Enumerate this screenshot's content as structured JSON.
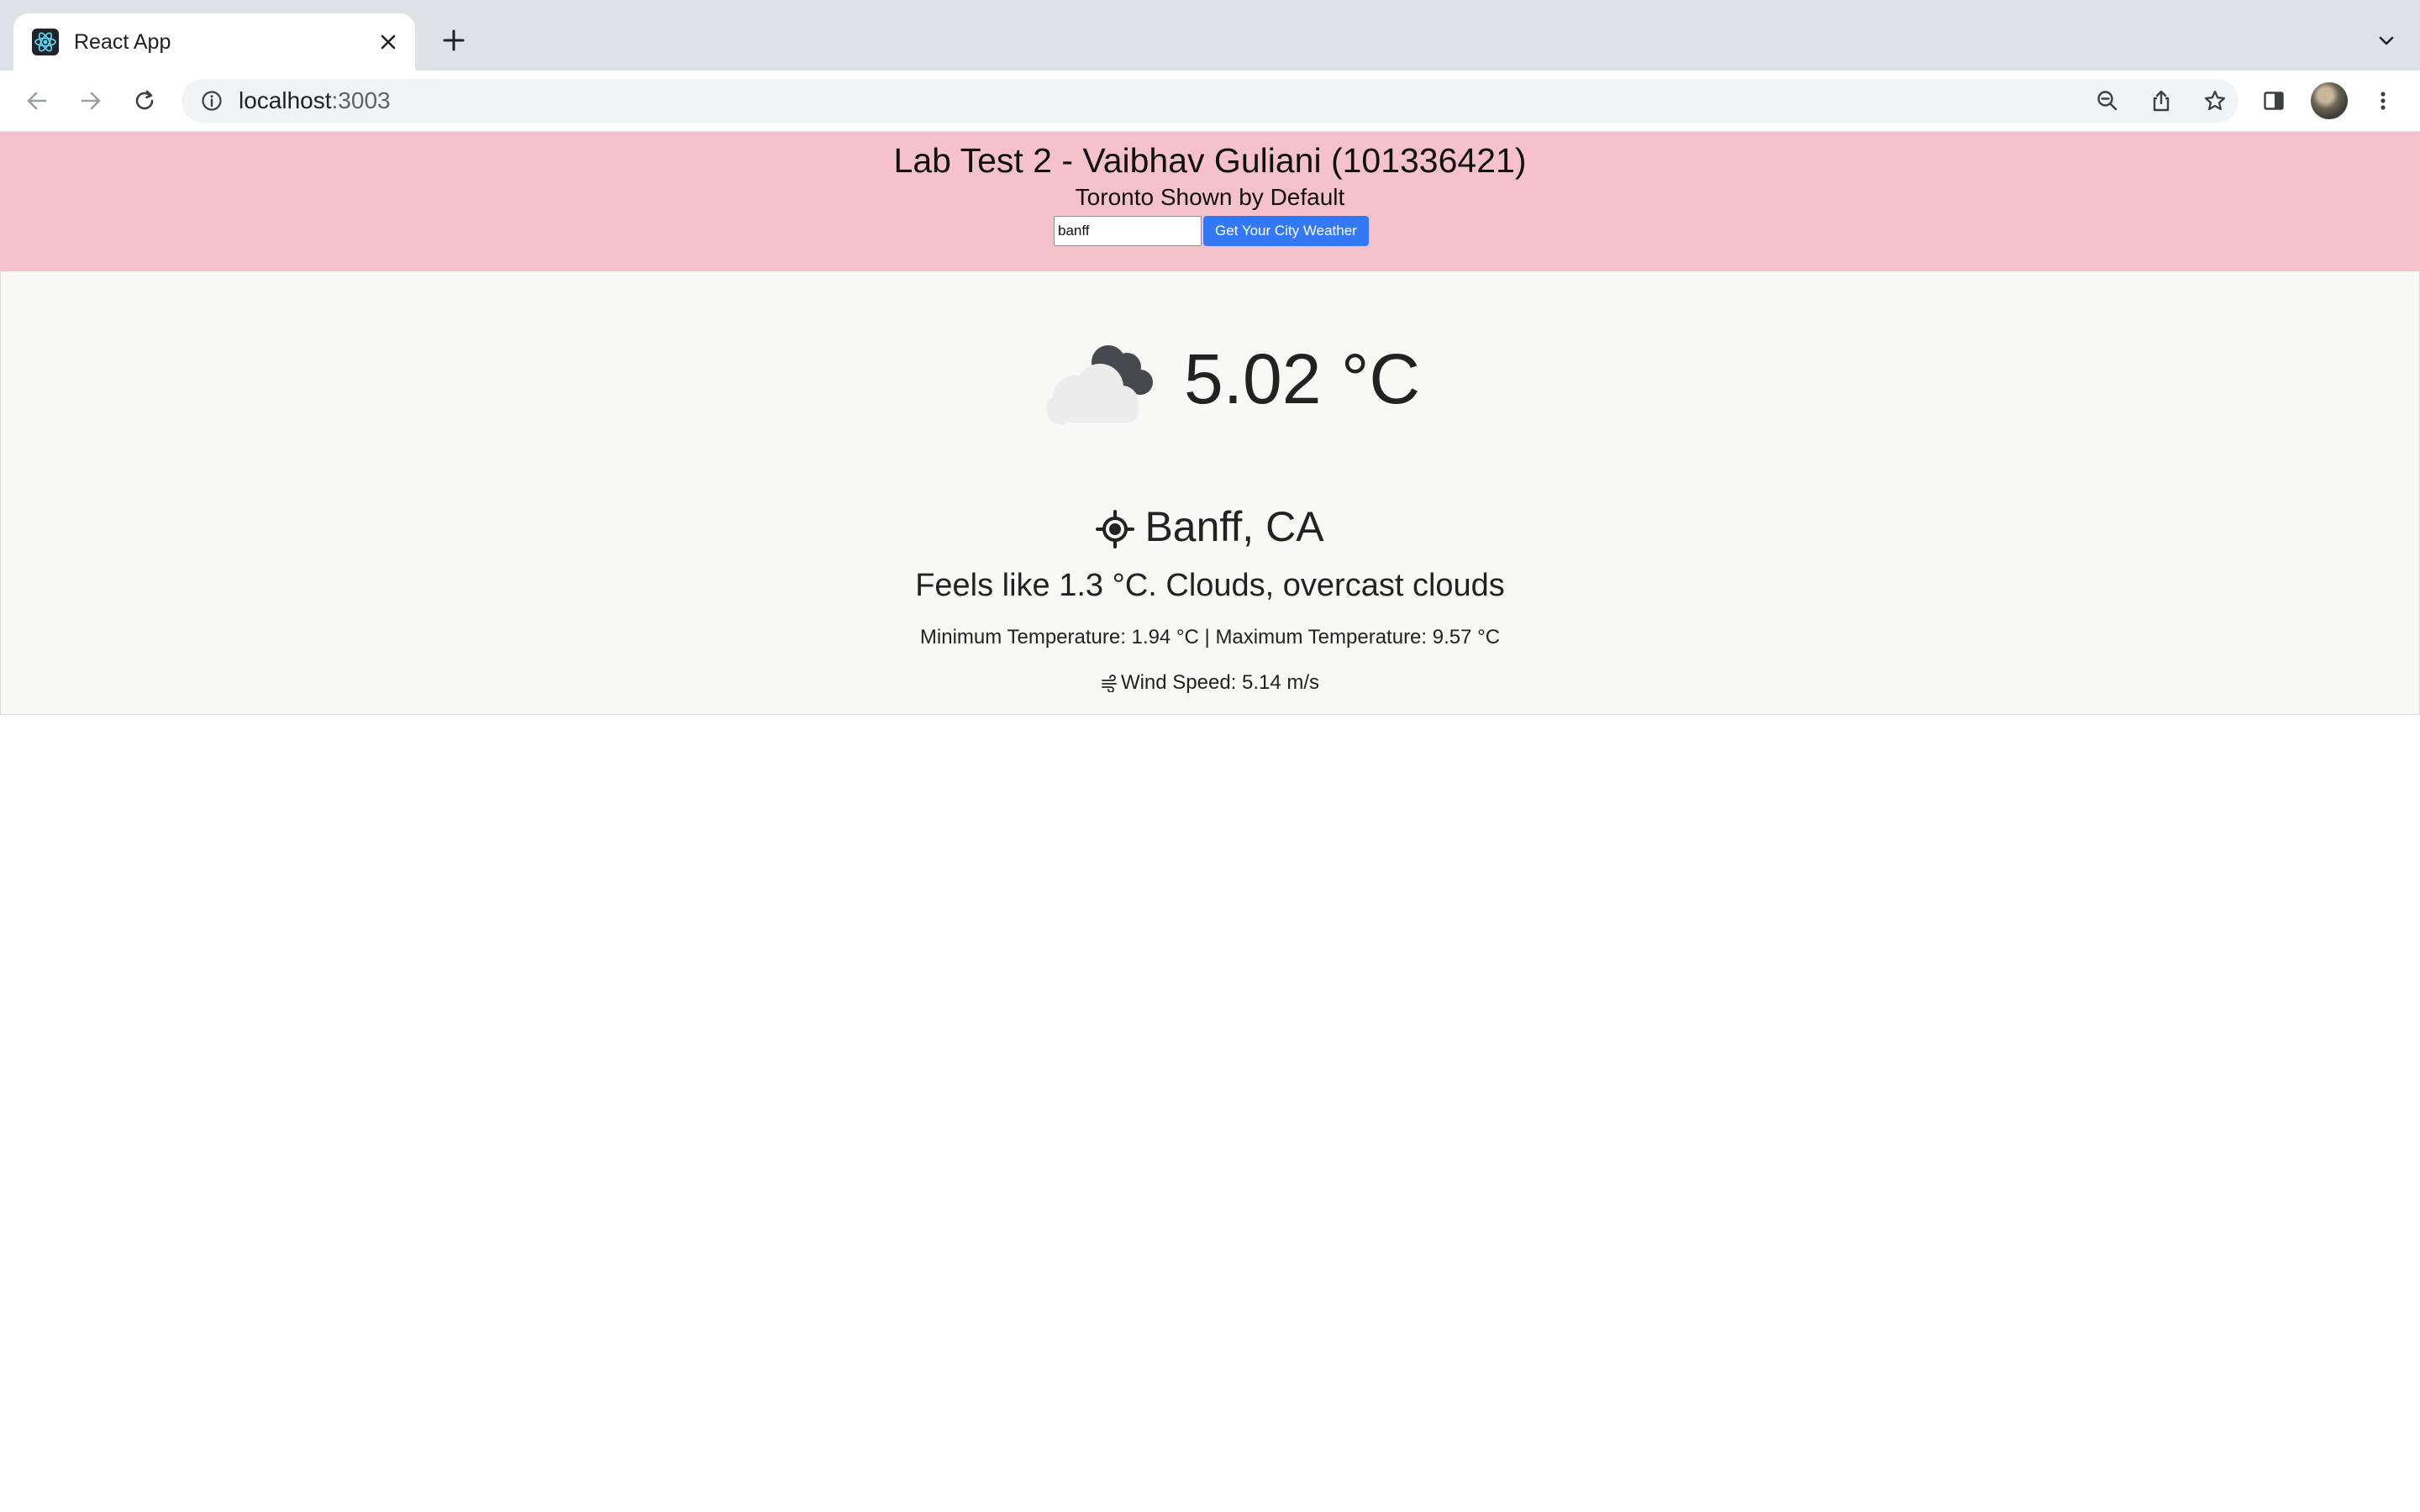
{
  "browser": {
    "tab_title": "React App",
    "url_host": "localhost",
    "url_port": ":3003"
  },
  "header": {
    "title": "Lab Test 2 - Vaibhav Guliani (101336421)",
    "subtitle": "Toronto Shown by Default",
    "search_value": "banff",
    "button_label": "Get Your City Weather",
    "background_color": "#f5c2cc",
    "button_color": "#3478f6"
  },
  "weather": {
    "icon": "cloud-icon",
    "temperature": "5.02 °C",
    "location": "Banff, CA",
    "feels_like": "Feels like 1.3 °C. Clouds, overcast clouds",
    "min_max": "Minimum Temperature: 1.94 °C | Maximum Temperature: 9.57 °C",
    "wind": "Wind Speed: 5.14 m/s"
  }
}
